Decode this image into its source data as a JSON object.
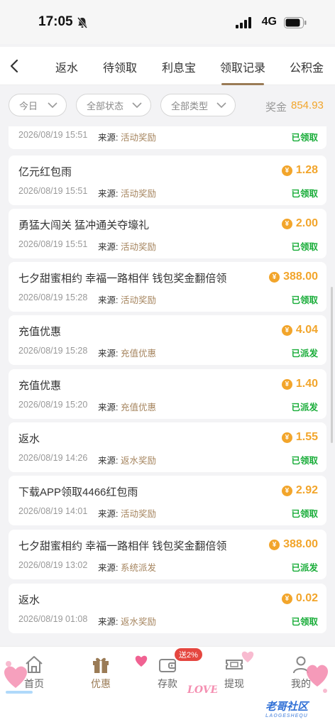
{
  "status_bar": {
    "time": "17:05",
    "network": "4G"
  },
  "tabs": [
    {
      "label": "返水",
      "active": false
    },
    {
      "label": "待领取",
      "active": false
    },
    {
      "label": "利息宝",
      "active": false
    },
    {
      "label": "领取记录",
      "active": true
    },
    {
      "label": "公积金",
      "active": false
    }
  ],
  "filters": {
    "date": "今日",
    "status": "全部状态",
    "type": "全部类型"
  },
  "bonus": {
    "label": "奖金",
    "value": "854.93"
  },
  "records": [
    {
      "title": "",
      "date": "2026/08/19 15:51",
      "source_label": "来源:",
      "source": "活动奖励",
      "amount": "",
      "status": "已领取"
    },
    {
      "title": "亿元红包雨",
      "date": "2026/08/19 15:51",
      "source_label": "来源:",
      "source": "活动奖励",
      "amount": "1.28",
      "status": "已领取"
    },
    {
      "title": "勇猛大闯关 猛冲通关夺壕礼",
      "date": "2026/08/19 15:51",
      "source_label": "来源:",
      "source": "活动奖励",
      "amount": "2.00",
      "status": "已领取"
    },
    {
      "title": "七夕甜蜜相约 幸福一路相伴 钱包奖金翻倍领",
      "date": "2026/08/19 15:28",
      "source_label": "来源:",
      "source": "活动奖励",
      "amount": "388.00",
      "status": "已领取"
    },
    {
      "title": "充值优惠",
      "date": "2026/08/19 15:28",
      "source_label": "来源:",
      "source": "充值优惠",
      "amount": "4.04",
      "status": "已派发"
    },
    {
      "title": "充值优惠",
      "date": "2026/08/19 15:20",
      "source_label": "来源:",
      "source": "充值优惠",
      "amount": "1.40",
      "status": "已派发"
    },
    {
      "title": "返水",
      "date": "2026/08/19 14:26",
      "source_label": "来源:",
      "source": "返水奖励",
      "amount": "1.55",
      "status": "已领取"
    },
    {
      "title": "下载APP领取4466红包雨",
      "date": "2026/08/19 14:01",
      "source_label": "来源:",
      "source": "活动奖励",
      "amount": "2.92",
      "status": "已领取"
    },
    {
      "title": "七夕甜蜜相约 幸福一路相伴 钱包奖金翻倍领",
      "date": "2026/08/19 13:02",
      "source_label": "来源:",
      "source": "系统派发",
      "amount": "388.00",
      "status": "已派发"
    },
    {
      "title": "返水",
      "date": "2026/08/19 01:08",
      "source_label": "来源:",
      "source": "返水奖励",
      "amount": "0.02",
      "status": "已领取"
    }
  ],
  "coin_symbol": "¥",
  "bottom_nav": {
    "home": "首页",
    "promo": "优惠",
    "deposit": "存款",
    "deposit_badge": "送2%",
    "withdraw": "提现",
    "mine": "我的"
  },
  "watermark": {
    "main": "老哥社区",
    "sub": "LAOGESHEQU"
  },
  "colors": {
    "accent": "#9a7b56",
    "gold": "#f2a52b",
    "green": "#1aad3a",
    "badge": "#e5463f"
  }
}
